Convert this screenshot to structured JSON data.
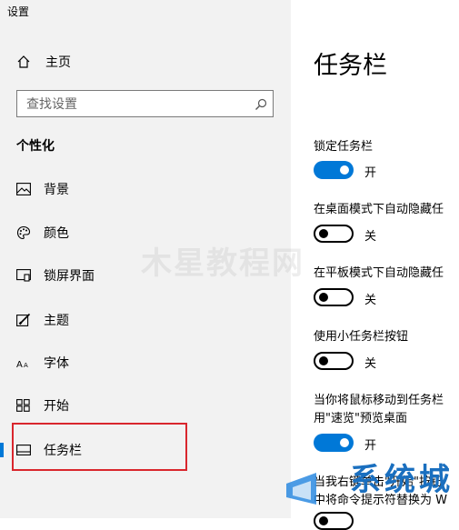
{
  "app": {
    "title": "设置"
  },
  "sidebar": {
    "home_label": "主页",
    "search_placeholder": "查找设置",
    "section_title": "个性化",
    "items": [
      {
        "label": "背景",
        "icon": "picture-icon"
      },
      {
        "label": "颜色",
        "icon": "palette-icon"
      },
      {
        "label": "锁屏界面",
        "icon": "lock-screen-icon"
      },
      {
        "label": "主题",
        "icon": "theme-icon"
      },
      {
        "label": "字体",
        "icon": "font-icon"
      },
      {
        "label": "开始",
        "icon": "start-icon"
      },
      {
        "label": "任务栏",
        "icon": "taskbar-icon",
        "selected": true
      }
    ]
  },
  "main": {
    "title": "任务栏",
    "settings": [
      {
        "label": "锁定任务栏",
        "state": "开",
        "on": true
      },
      {
        "label": "在桌面模式下自动隐藏任",
        "state": "关",
        "on": false
      },
      {
        "label": "在平板模式下自动隐藏任",
        "state": "关",
        "on": false
      },
      {
        "label": "使用小任务栏按钮",
        "state": "关",
        "on": false
      },
      {
        "label_line1": "当你将鼠标移动到任务栏",
        "label_line2": "用\"速览\"预览桌面",
        "state": "开",
        "on": true
      },
      {
        "label_line1": "当我右键单击\"开始\"按钮",
        "label_line2": "中将命令提示符替换为 W"
      }
    ]
  },
  "watermark": {
    "text": "木星教程网"
  },
  "logo": {
    "text": "系统城"
  },
  "colors": {
    "accent": "#0078d7",
    "highlight": "#d9262d",
    "sidebar_bg": "#f2f2f2"
  }
}
